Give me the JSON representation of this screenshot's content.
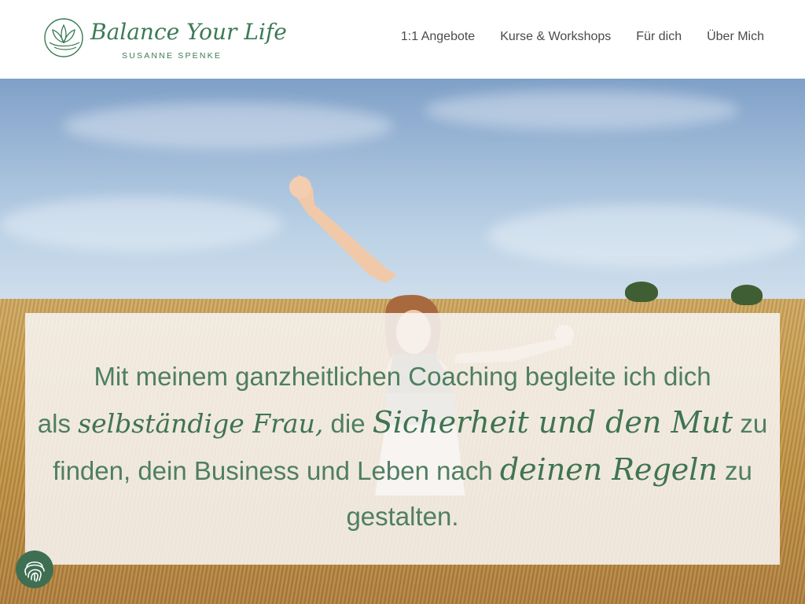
{
  "brand": {
    "title": "Balance Your Life",
    "subtitle": "SUSANNE SPENKE",
    "icon": "lotus-icon",
    "color": "#3c7a56"
  },
  "nav": {
    "items": [
      {
        "label": "1:1 Angebote"
      },
      {
        "label": "Kurse & Workshops"
      },
      {
        "label": "Für dich"
      },
      {
        "label": "Über Mich"
      }
    ]
  },
  "hero": {
    "quote": {
      "line1": "Mit meinem ganzheitlichen Coaching begleite ich dich",
      "line2_a": "als ",
      "line2_script1": "selbständige Frau,",
      "line2_b": " die ",
      "line2_script2": "Sicherheit und den Mut",
      "line2_c": " zu",
      "line3_a": "finden, dein Business und Leben nach ",
      "line3_script": "deinen Regeln",
      "line3_b": " zu",
      "line4": "gestalten."
    },
    "text_color": "#4e7f60"
  },
  "widgets": {
    "fingerprint_icon": "fingerprint-icon",
    "fingerprint_color": "#3f6f52"
  }
}
